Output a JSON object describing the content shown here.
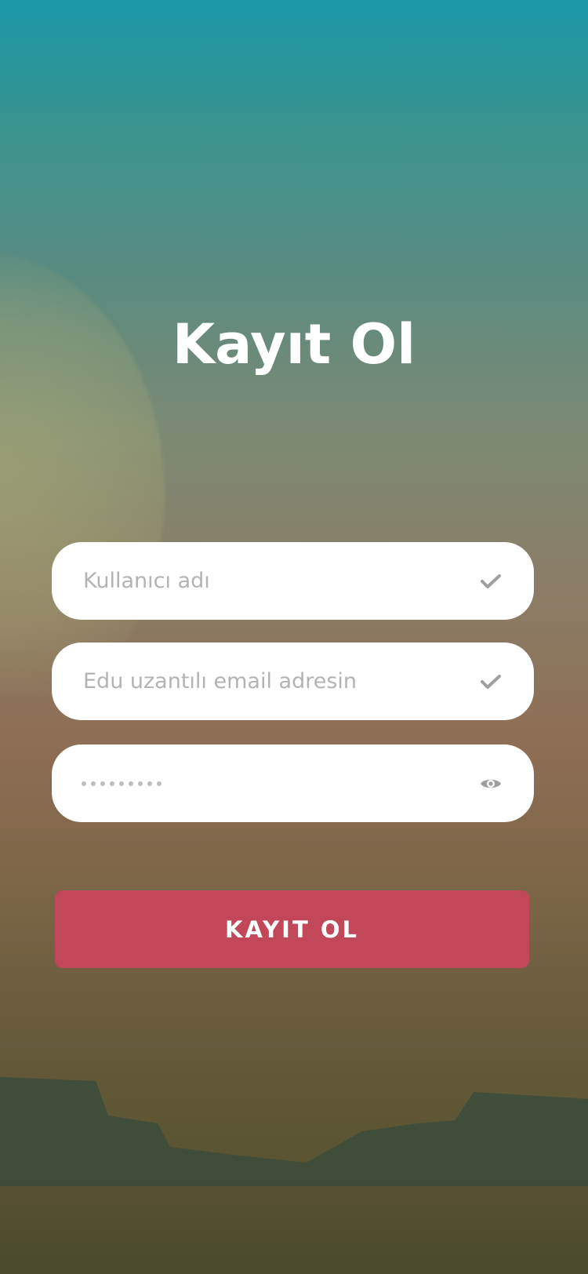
{
  "page": {
    "title": "Kayıt Ol"
  },
  "form": {
    "username": {
      "placeholder": "Kullanıcı adı",
      "icon": "check-icon"
    },
    "email": {
      "placeholder": "Edu uzantılı email adresin",
      "icon": "check-icon"
    },
    "password": {
      "masked_length": 9,
      "icon": "eye-icon"
    },
    "submit_label": "KAYIT OL"
  },
  "colors": {
    "button": "#c24859",
    "field_bg": "#ffffff",
    "placeholder": "#b3b3b3",
    "icon": "#9f9f9f"
  }
}
